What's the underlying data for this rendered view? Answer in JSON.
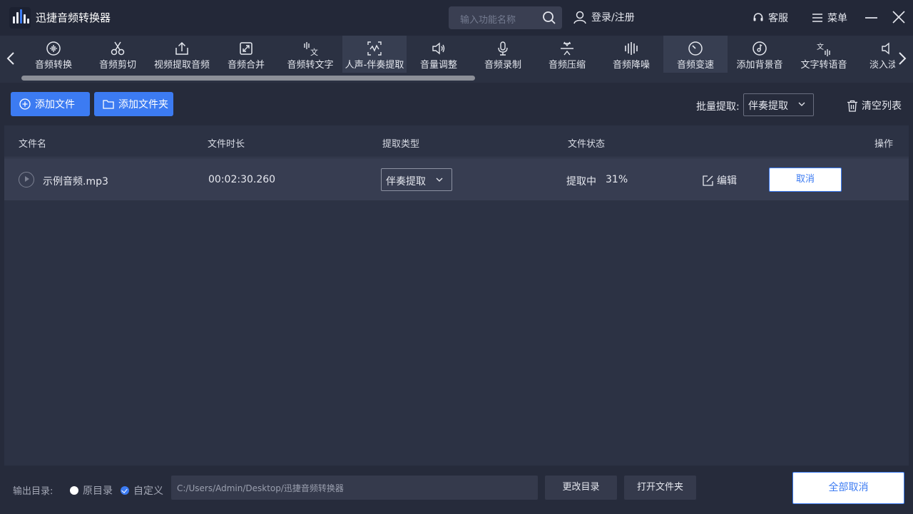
{
  "app": {
    "title": "迅捷音频转换器"
  },
  "header": {
    "search_placeholder": "输入功能名称",
    "login": "登录/注册",
    "service": "客服",
    "menu": "菜单"
  },
  "tools": [
    {
      "label": "音频转换",
      "icon": "waveform-circle-icon"
    },
    {
      "label": "音频剪切",
      "icon": "scissors-icon"
    },
    {
      "label": "视频提取音频",
      "icon": "export-icon"
    },
    {
      "label": "音频合并",
      "icon": "merge-arrows-icon"
    },
    {
      "label": "音频转文字",
      "icon": "speech-to-text-icon"
    },
    {
      "label": "人声-伴奏提取",
      "icon": "vocal-extract-icon"
    },
    {
      "label": "音量调整",
      "icon": "speaker-icon"
    },
    {
      "label": "音频录制",
      "icon": "microphone-icon"
    },
    {
      "label": "音频压缩",
      "icon": "compress-icon"
    },
    {
      "label": "音频降噪",
      "icon": "equalizer-icon"
    },
    {
      "label": "音频变速",
      "icon": "speed-dial-icon"
    },
    {
      "label": "添加背景音",
      "icon": "music-disc-icon"
    },
    {
      "label": "文字转语音",
      "icon": "text-to-speech-icon"
    },
    {
      "label": "淡入淡出",
      "icon": "fade-icon"
    }
  ],
  "actions": {
    "add_file": "添加文件",
    "add_folder": "添加文件夹",
    "batch_label": "批量提取:",
    "batch_value": "伴奏提取",
    "clear_list": "清空列表"
  },
  "table": {
    "headers": {
      "name": "文件名",
      "duration": "文件时长",
      "type": "提取类型",
      "status": "文件状态",
      "op": "操作"
    },
    "rows": [
      {
        "name": "示例音频.mp3",
        "duration": "00:02:30.260",
        "type": "伴奏提取",
        "status": "提取中",
        "progress": "31%",
        "edit": "编辑",
        "cancel": "取消"
      }
    ]
  },
  "footer": {
    "output_label": "输出目录:",
    "option_original": "原目录",
    "option_custom": "自定义",
    "selected_option": "自定义",
    "path": "C:/Users/Admin/Desktop/迅捷音频转换器",
    "change_dir": "更改目录",
    "open_folder": "打开文件夹",
    "cancel_all": "全部取消"
  },
  "colors": {
    "accent": "#3c7bf2",
    "background": "#262b3b",
    "row": "#373d51"
  }
}
